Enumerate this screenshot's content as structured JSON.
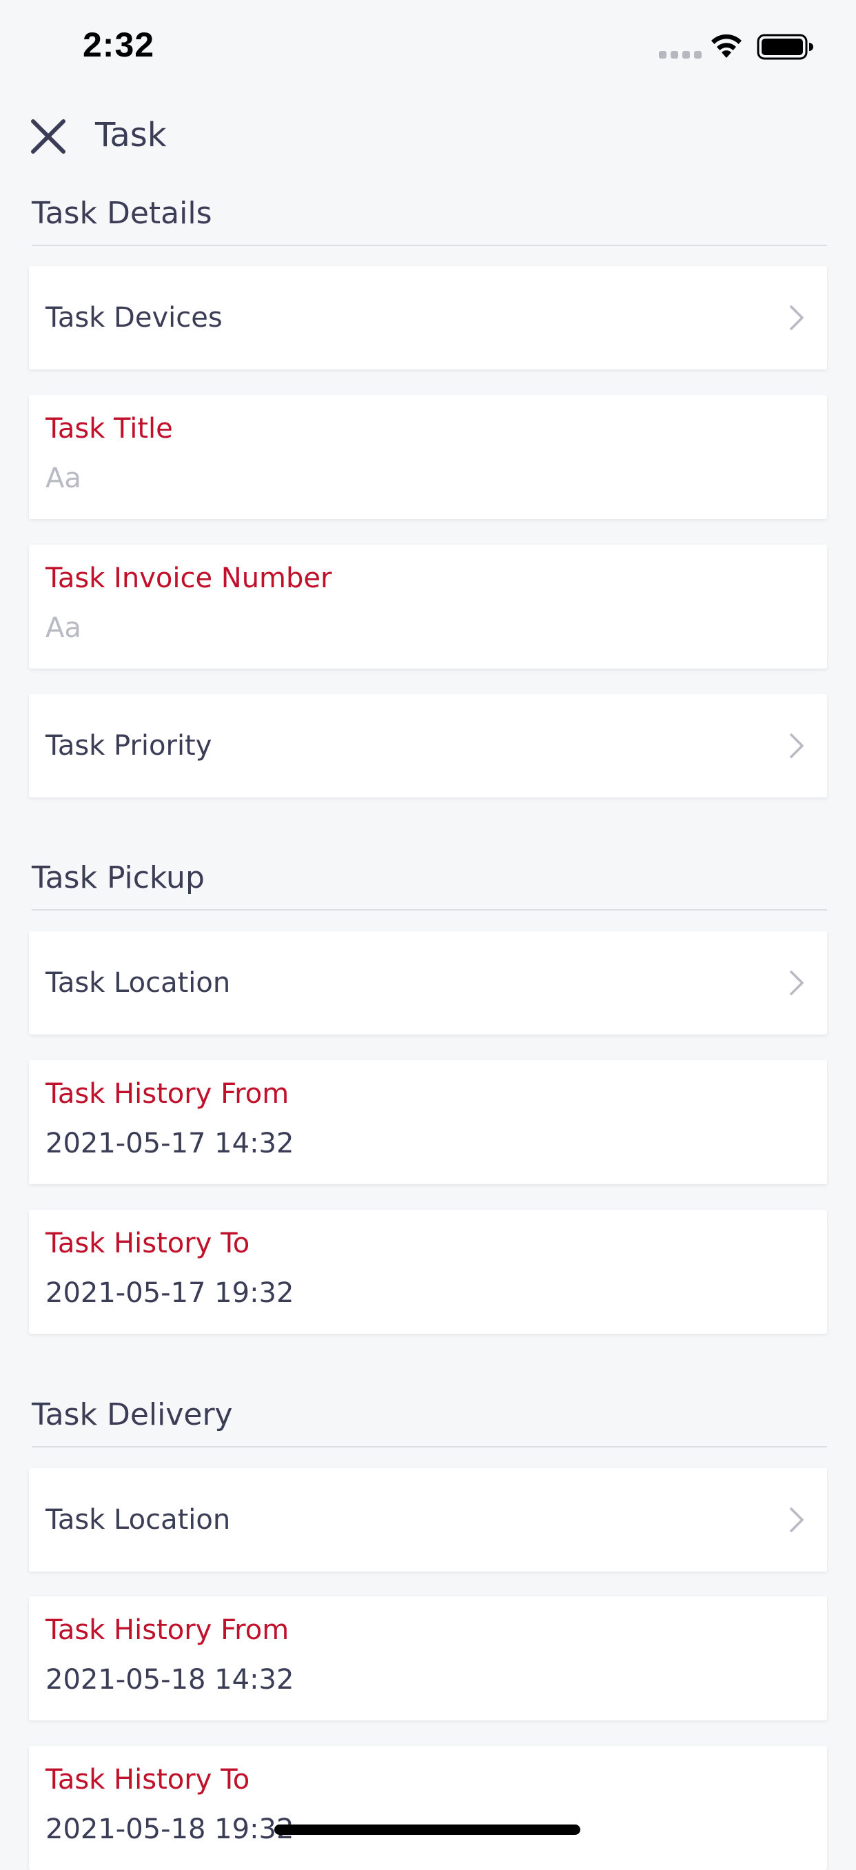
{
  "status_bar": {
    "time": "2:32",
    "icons": [
      "cellular-signal-icon",
      "wifi-icon",
      "battery-icon"
    ]
  },
  "nav": {
    "title": "Task",
    "close_icon": "close-icon"
  },
  "colors": {
    "required_label": "#c0102a",
    "text": "#3a3d55",
    "placeholder": "#b8b9c3",
    "background": "#f6f7f9",
    "card": "#ffffff"
  },
  "details": {
    "title": "Task Details",
    "devices_label": "Task Devices",
    "task_title_label": "Task Title",
    "task_title_placeholder": "Aa",
    "invoice_label": "Task Invoice Number",
    "invoice_placeholder": "Aa",
    "priority_label": "Task Priority"
  },
  "pickup": {
    "title": "Task Pickup",
    "location_label": "Task Location",
    "history_from_label": "Task History From",
    "history_from_value": "2021-05-17 14:32",
    "history_to_label": "Task History To",
    "history_to_value": "2021-05-17 19:32"
  },
  "delivery": {
    "title": "Task Delivery",
    "location_label": "Task Location",
    "history_from_label": "Task History From",
    "history_from_value": "2021-05-18 14:32",
    "history_to_label": "Task History To",
    "history_to_value": "2021-05-18 19:32"
  }
}
